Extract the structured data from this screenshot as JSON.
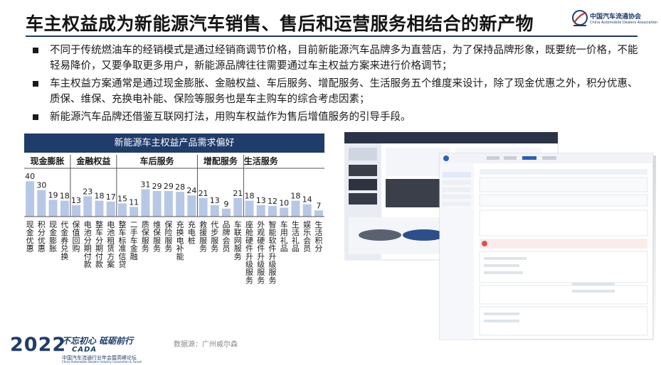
{
  "slide": {
    "title": "车主权益成为新能源汽车销售、售后和运营服务相结合的新产物",
    "logo_cn": "中国汽车流通协会",
    "logo_en": "China Automobile Dealers Association",
    "bullets": [
      "不同于传统燃油车的经销模式是通过经销商调节价格，目前新能源汽车品牌多为直营店，为了保持品牌形象，既要统一价格，不能轻易降价，又要争取更多用户，新能源品牌往往需要通过车主权益方案来进行价格调节；",
      "车主权益方案通常是通过现金膨胀、金融权益、车后服务、增配服务、生活服务五个维度来设计，除了现金优惠之外，积分优惠、质保、维保、充换电补能、保险等服务也是车主购车的综合考虑因素；",
      "新能源汽车品牌还借鉴互联网打法，用购车权益作为售后增值服务的引导手段。"
    ],
    "source": "数据源：广州威尔森"
  },
  "footer": {
    "year": "2022",
    "slogan": "不忘初心 砥砺前行",
    "brand": "CADA",
    "org": "中国汽车流通行业年会暨高峰论坛",
    "org_en": "China Automobile Dealers Industry Convention & Forum"
  },
  "chart_data": {
    "type": "bar",
    "title": "新能源车主权益产品需求偏好",
    "bar_color": "#b7c8e6",
    "header_color": "#1f3c6b",
    "groups": [
      {
        "name": "现金膨胀",
        "start": 0,
        "end": 4
      },
      {
        "name": "金融权益",
        "start": 4,
        "end": 8
      },
      {
        "name": "车后服务",
        "start": 8,
        "end": 15
      },
      {
        "name": "增配服务",
        "start": 15,
        "end": 19
      },
      {
        "name": "生活服务",
        "start": 19,
        "end": 22
      }
    ],
    "categories": [
      "现金优惠",
      "积分优惠",
      "现金膨胀",
      "代金券兑换",
      "保值回购",
      "电池分期付款",
      "整车分期付款",
      "电池租赁方案",
      "整车标准信贷",
      "二手车金融",
      "质保服务",
      "维保服务",
      "保险服务",
      "充换电补能",
      "充电桩",
      "救援服务",
      "代步服务",
      "品牌会员",
      "车联网服务",
      "座舱硬件升级服务",
      "外观硬件升级服务",
      "智能软件升级服务",
      "车用礼品",
      "生活礼品",
      "娱乐会员",
      "生活积分"
    ],
    "values": [
      40,
      30,
      19,
      18,
      13,
      23,
      18,
      17,
      15,
      11,
      31,
      29,
      29,
      28,
      24,
      21,
      13,
      9,
      21,
      18,
      13,
      12,
      10,
      18,
      14,
      7
    ],
    "ylim": [
      0,
      45
    ]
  }
}
